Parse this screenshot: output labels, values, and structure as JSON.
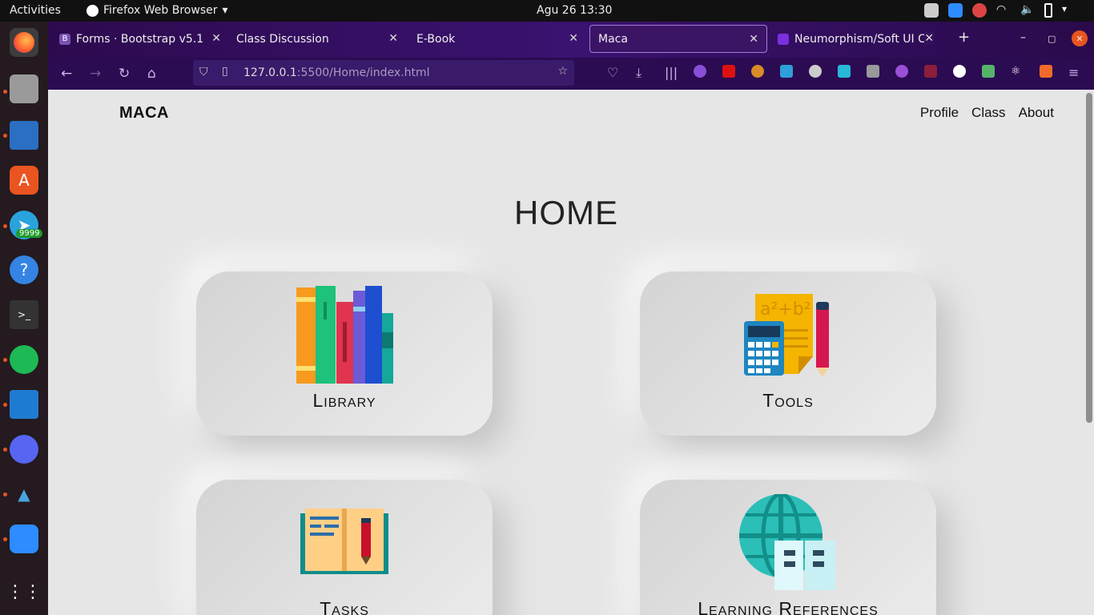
{
  "system": {
    "activities": "Activities",
    "app_menu": "Firefox Web Browser",
    "clock": "Agu 26  13:30",
    "dock_badge": "9999"
  },
  "browser": {
    "tabs": [
      {
        "label": "Forms · Bootstrap v5.1",
        "icon": "bootstrap-icon",
        "color": "#7952b3"
      },
      {
        "label": "Class Discussion",
        "icon": "none"
      },
      {
        "label": "E-Book",
        "icon": "none"
      },
      {
        "label": "Maca",
        "icon": "none"
      },
      {
        "label": "Neumorphism/Soft UI CSS",
        "icon": "neumorphism-icon",
        "color": "#7a2fe0"
      }
    ],
    "url_host": "127.0.0.1",
    "url_path": ":5500/Home/index.html"
  },
  "site": {
    "brand": "MACA",
    "nav": [
      "Profile",
      "Class",
      "About"
    ],
    "title": "HOME",
    "cards": [
      {
        "label": "Library",
        "icon": "books-icon"
      },
      {
        "label": "Tools",
        "icon": "calculator-icon"
      },
      {
        "label": "Tasks",
        "icon": "open-book-icon"
      },
      {
        "label": "Learning References",
        "icon": "globe-book-icon"
      }
    ]
  },
  "colors": {
    "page_bg": "#e6e6e6",
    "tabbar": "#2d0a4e",
    "dock": "#241a1f"
  }
}
